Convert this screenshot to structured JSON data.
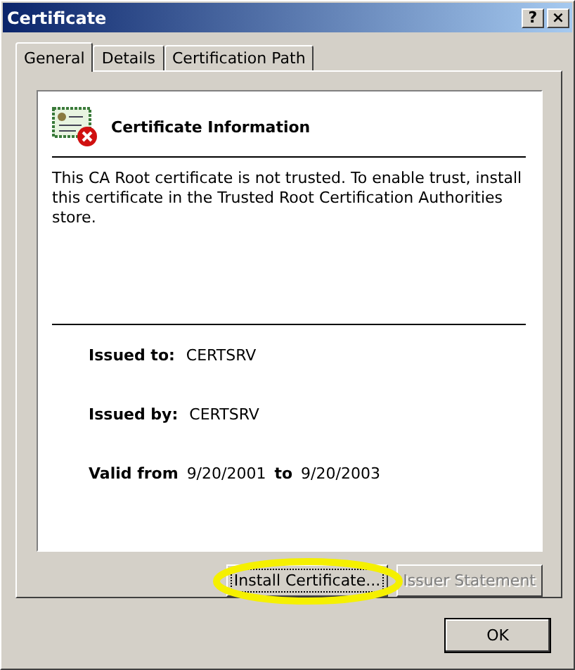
{
  "window": {
    "title": "Certificate",
    "title_buttons": [
      "?",
      "×"
    ]
  },
  "tabs": [
    {
      "label": "General",
      "selected": true
    },
    {
      "label": "Details",
      "selected": false
    },
    {
      "label": "Certification Path",
      "selected": false
    }
  ],
  "info": {
    "heading": "Certificate Information",
    "trusted": false,
    "message": "This CA Root certificate is not trusted. To enable trust, install this certificate in the Trusted Root Certification Authorities store."
  },
  "fields": [
    {
      "label": "Issued to:",
      "value": "CERTSRV"
    },
    {
      "label": "Issued by:",
      "value": "CERTSRV"
    }
  ],
  "validity": {
    "label": "Valid from",
    "from": "9/20/2001",
    "to_label": "to",
    "to": "9/20/2003"
  },
  "panel_buttons": [
    {
      "label": "Install Certificate...",
      "disabled": false,
      "focused": true,
      "highlighted": true
    },
    {
      "label": "Issuer Statement",
      "disabled": true,
      "focused": false,
      "highlighted": false
    }
  ],
  "dialog_buttons": [
    {
      "label": "OK"
    }
  ]
}
